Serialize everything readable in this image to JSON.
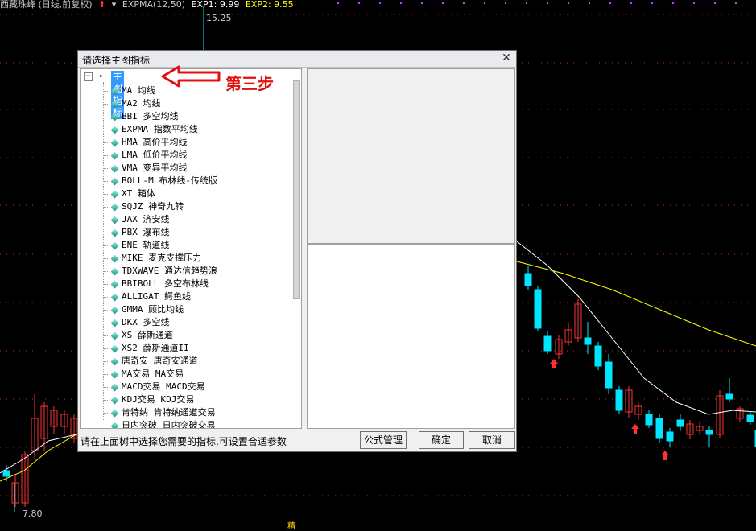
{
  "chart_header": {
    "stock_label": "西藏珠峰 (日线,前复权)",
    "indicator": "EXPMA(12,50)",
    "exp1": "EXP1: 9.99",
    "exp2": "EXP2: 9.55",
    "high_label": "15.25",
    "low_label": "7.80",
    "bottom_mark": "精"
  },
  "colors": {
    "up": "#ff3232",
    "down": "#00e5ff",
    "exp1_line": "#ffffff",
    "exp2_line": "#ffff00",
    "exp2_text": "#ffff00",
    "grid": "#ff3232",
    "annotation": "#e01010"
  },
  "dialog": {
    "title": "请选择主图指标",
    "close_icon": "close-icon",
    "tree_root": "主图指标",
    "tree_items": [
      "MA 均线",
      "MA2 均线",
      "BBI 多空均线",
      "EXPMA 指数平均线",
      "HMA 高价平均线",
      "LMA 低价平均线",
      "VMA 变异平均线",
      "BOLL-M 布林线-传统版",
      "XT 箱体",
      "SQJZ 神奇九转",
      "JAX 济安线",
      "PBX 瀑布线",
      "ENE 轨道线",
      "MIKE 麦克支撑压力",
      "TDXWAVE 通达信趋势浪",
      "BBIBOLL 多空布林线",
      "ALLIGAT 鳄鱼线",
      "GMMA 顾比均线",
      "DKX 多空线",
      "XS 薛斯通道",
      "XS2 薛斯通道II",
      "唐奇安 唐奇安通道",
      "MA交易 MA交易",
      "MACD交易 MACD交易",
      "KDJ交易 KDJ交易",
      "肯特纳 肯特纳通道交易",
      "日内突破 日内突破交易"
    ],
    "status_text": "请在上面树中选择您需要的指标,可设置合适参数",
    "btn_formula": "公式管理",
    "btn_ok": "确定",
    "btn_cancel": "取消"
  },
  "annotation": {
    "text": "第三步",
    "arrow_icon": "red-left-arrow-icon"
  }
}
